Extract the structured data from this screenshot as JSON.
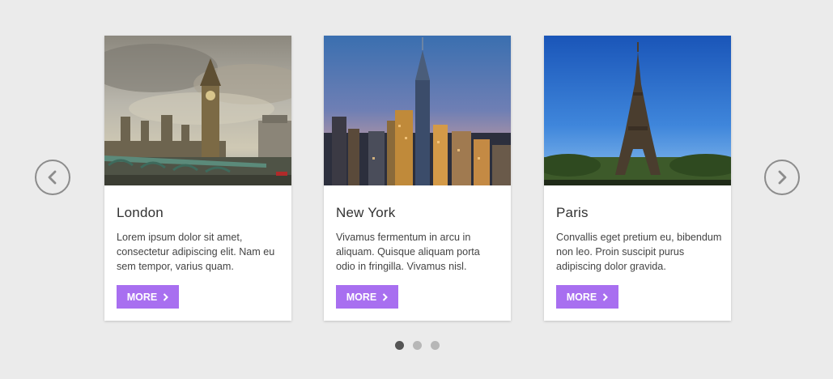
{
  "carousel": {
    "prev_icon": "chevron-left-circle-icon",
    "next_icon": "chevron-right-circle-icon",
    "accent_color": "#a86ff0",
    "active_index": 0,
    "page_count": 3
  },
  "cards": [
    {
      "title": "London",
      "text": "Lorem ipsum dolor sit amet, consectetur adipiscing elit. Nam eu sem tempor, varius quam.",
      "button_label": "MORE"
    },
    {
      "title": "New York",
      "text": "Vivamus fermentum in arcu in aliquam. Quisque aliquam porta odio in fringilla. Vivamus nisl.",
      "button_label": "MORE"
    },
    {
      "title": "Paris",
      "text": "Convallis eget pretium eu, bibendum non leo. Proin suscipit purus adipiscing dolor gravida.",
      "button_label": "MORE"
    }
  ]
}
